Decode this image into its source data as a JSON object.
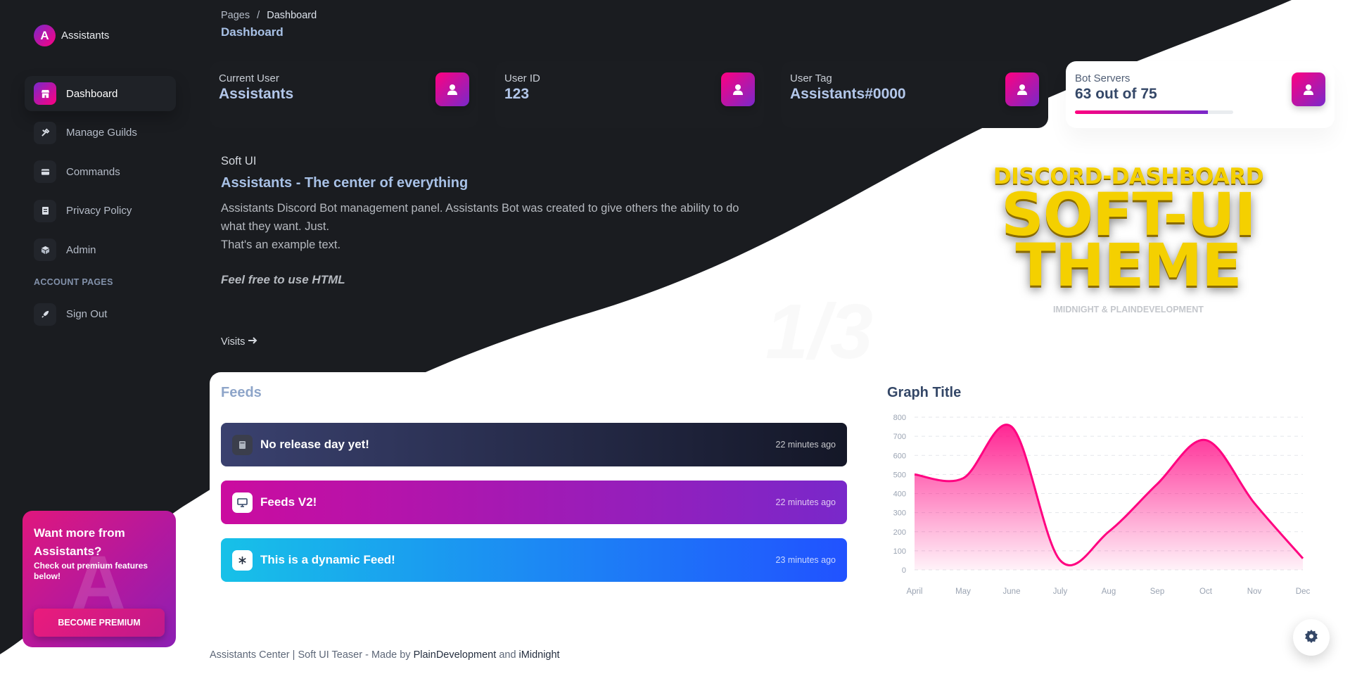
{
  "sidebar": {
    "brand": {
      "logo_letter": "A",
      "name": "Assistants"
    },
    "items": [
      {
        "label": "Dashboard",
        "icon": "shop-icon"
      },
      {
        "label": "Manage Guilds",
        "icon": "tools-icon"
      },
      {
        "label": "Commands",
        "icon": "card-icon"
      },
      {
        "label": "Privacy Policy",
        "icon": "document-icon"
      },
      {
        "label": "Admin",
        "icon": "box-icon"
      }
    ],
    "section_label": "ACCOUNT PAGES",
    "sign_out": {
      "label": "Sign Out",
      "icon": "rocket-icon"
    },
    "premium": {
      "watermark": "A",
      "title": "Want more from Assistants?",
      "text": "Check out premium features below!",
      "button": "BECOME PREMIUM"
    }
  },
  "header": {
    "breadcrumb": {
      "root": "Pages",
      "separator": "/",
      "current": "Dashboard"
    },
    "title": "Dashboard"
  },
  "stats": [
    {
      "label": "Current User",
      "value": "Assistants",
      "icon": "user-icon"
    },
    {
      "label": "User ID",
      "value": "123",
      "icon": "user-icon"
    },
    {
      "label": "User Tag",
      "value": "Assistants#0000",
      "icon": "user-icon"
    },
    {
      "label": "Bot Servers",
      "value": "63 out of 75",
      "icon": "user-icon",
      "progress": 0.84
    }
  ],
  "welcome": {
    "subtitle": "Soft UI",
    "title": "Assistants - The center of everything",
    "description": "Assistants Discord Bot management panel. Assistants Bot was created to give others the ability to do what they want. Just.",
    "description2": "That's an example text.",
    "italic": "Feel free to use HTML",
    "link": "Visits",
    "watermark": "1/3",
    "hero": {
      "line1": "DISCORD-DASHBOARD",
      "line2": "SOFT-UI",
      "line3": "THEME",
      "credit": "IMIDNIGHT & PLAINDEVELOPMENT"
    }
  },
  "feeds": {
    "title": "Feeds",
    "items": [
      {
        "title": "No release day yet!",
        "time": "22 minutes ago",
        "icon": "book-icon",
        "gradient": [
          "#3a416f",
          "#141727"
        ]
      },
      {
        "title": "Feeds V2!",
        "time": "22 minutes ago",
        "icon": "monitor-icon",
        "gradient": [
          "#cb0c9f",
          "#7928ca"
        ]
      },
      {
        "title": "This is a dynamic Feed!",
        "time": "23 minutes ago",
        "icon": "asterisk-icon",
        "gradient": [
          "#17c1e8",
          "#2152ff"
        ]
      }
    ]
  },
  "graph": {
    "title": "Graph Title"
  },
  "chart_data": {
    "type": "area",
    "title": "Graph Title",
    "categories": [
      "April",
      "May",
      "June",
      "July",
      "Aug",
      "Sep",
      "Oct",
      "Nov",
      "Dec"
    ],
    "series": [
      {
        "values": [
          500,
          480,
          750,
          50,
          200,
          450,
          680,
          350,
          60
        ]
      }
    ],
    "ylim": [
      0,
      800
    ],
    "yticks": [
      0,
      100,
      200,
      300,
      400,
      500,
      600,
      700,
      800
    ],
    "grid": true,
    "colors": {
      "line": "#ff0080",
      "fill_top": "#ff0080"
    }
  },
  "footer": {
    "text": "Assistants Center | Soft UI Teaser - Made by",
    "link1": "PlainDevelopment",
    "and": "and",
    "link2": "iMidnight"
  },
  "colors": {
    "dark_bg": "#1a1c20",
    "accent_gradient": [
      "#ff0080",
      "#7928ca"
    ]
  }
}
